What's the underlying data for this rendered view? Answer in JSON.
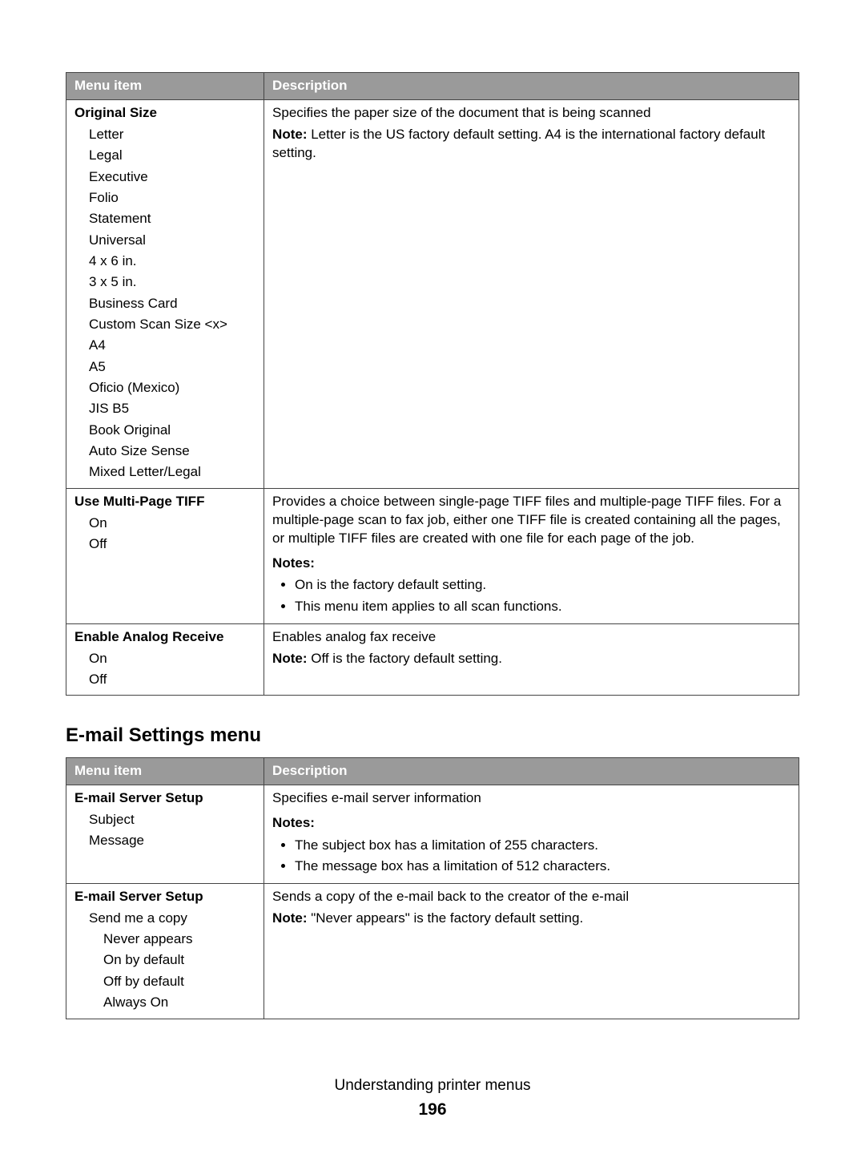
{
  "table1": {
    "headers": {
      "menu": "Menu item",
      "desc": "Description"
    },
    "rows": [
      {
        "title": "Original Size",
        "options": [
          "Letter",
          "Legal",
          "Executive",
          "Folio",
          "Statement",
          "Universal",
          "4 x 6 in.",
          "3 x 5 in.",
          "Business Card",
          "Custom Scan Size <x>",
          "A4",
          "A5",
          "Oficio (Mexico)",
          "JIS B5",
          "Book Original",
          "Auto Size Sense",
          "Mixed Letter/Legal"
        ],
        "desc": "Specifies the paper size of the document that is being scanned",
        "note_label": "Note:",
        "note_text": " Letter is the US factory default setting. A4 is the international factory default setting."
      },
      {
        "title": "Use Multi-Page TIFF",
        "options": [
          "On",
          "Off"
        ],
        "desc": "Provides a choice between single-page TIFF files and multiple-page TIFF files. For a multiple-page scan to fax job, either one TIFF file is created containing all the pages, or multiple TIFF files are created with one file for each page of the job.",
        "notes_heading": "Notes:",
        "bullets": [
          "On is the factory default setting.",
          "This menu item applies to all scan functions."
        ]
      },
      {
        "title": "Enable Analog Receive",
        "options": [
          "On",
          "Off"
        ],
        "desc": "Enables analog fax receive",
        "note_label": "Note:",
        "note_text": " Off is the factory default setting."
      }
    ]
  },
  "section_heading": "E-mail Settings menu",
  "table2": {
    "headers": {
      "menu": "Menu item",
      "desc": "Description"
    },
    "rows": [
      {
        "title": "E-mail Server Setup",
        "options": [
          "Subject",
          "Message"
        ],
        "desc": "Specifies e-mail server information",
        "notes_heading": "Notes:",
        "bullets": [
          "The subject box has a limitation of 255 characters.",
          "The message box has a limitation of 512 characters."
        ]
      },
      {
        "title": "E-mail Server Setup",
        "nested": {
          "parent": "Send me a copy",
          "children": [
            "Never appears",
            "On by default",
            "Off by default",
            "Always On"
          ]
        },
        "desc": "Sends a copy of the e-mail back to the creator of the e-mail",
        "note_label": "Note:",
        "note_text": " \"Never appears\" is the factory default setting."
      }
    ]
  },
  "footer": {
    "title": "Understanding printer menus",
    "page": "196"
  }
}
